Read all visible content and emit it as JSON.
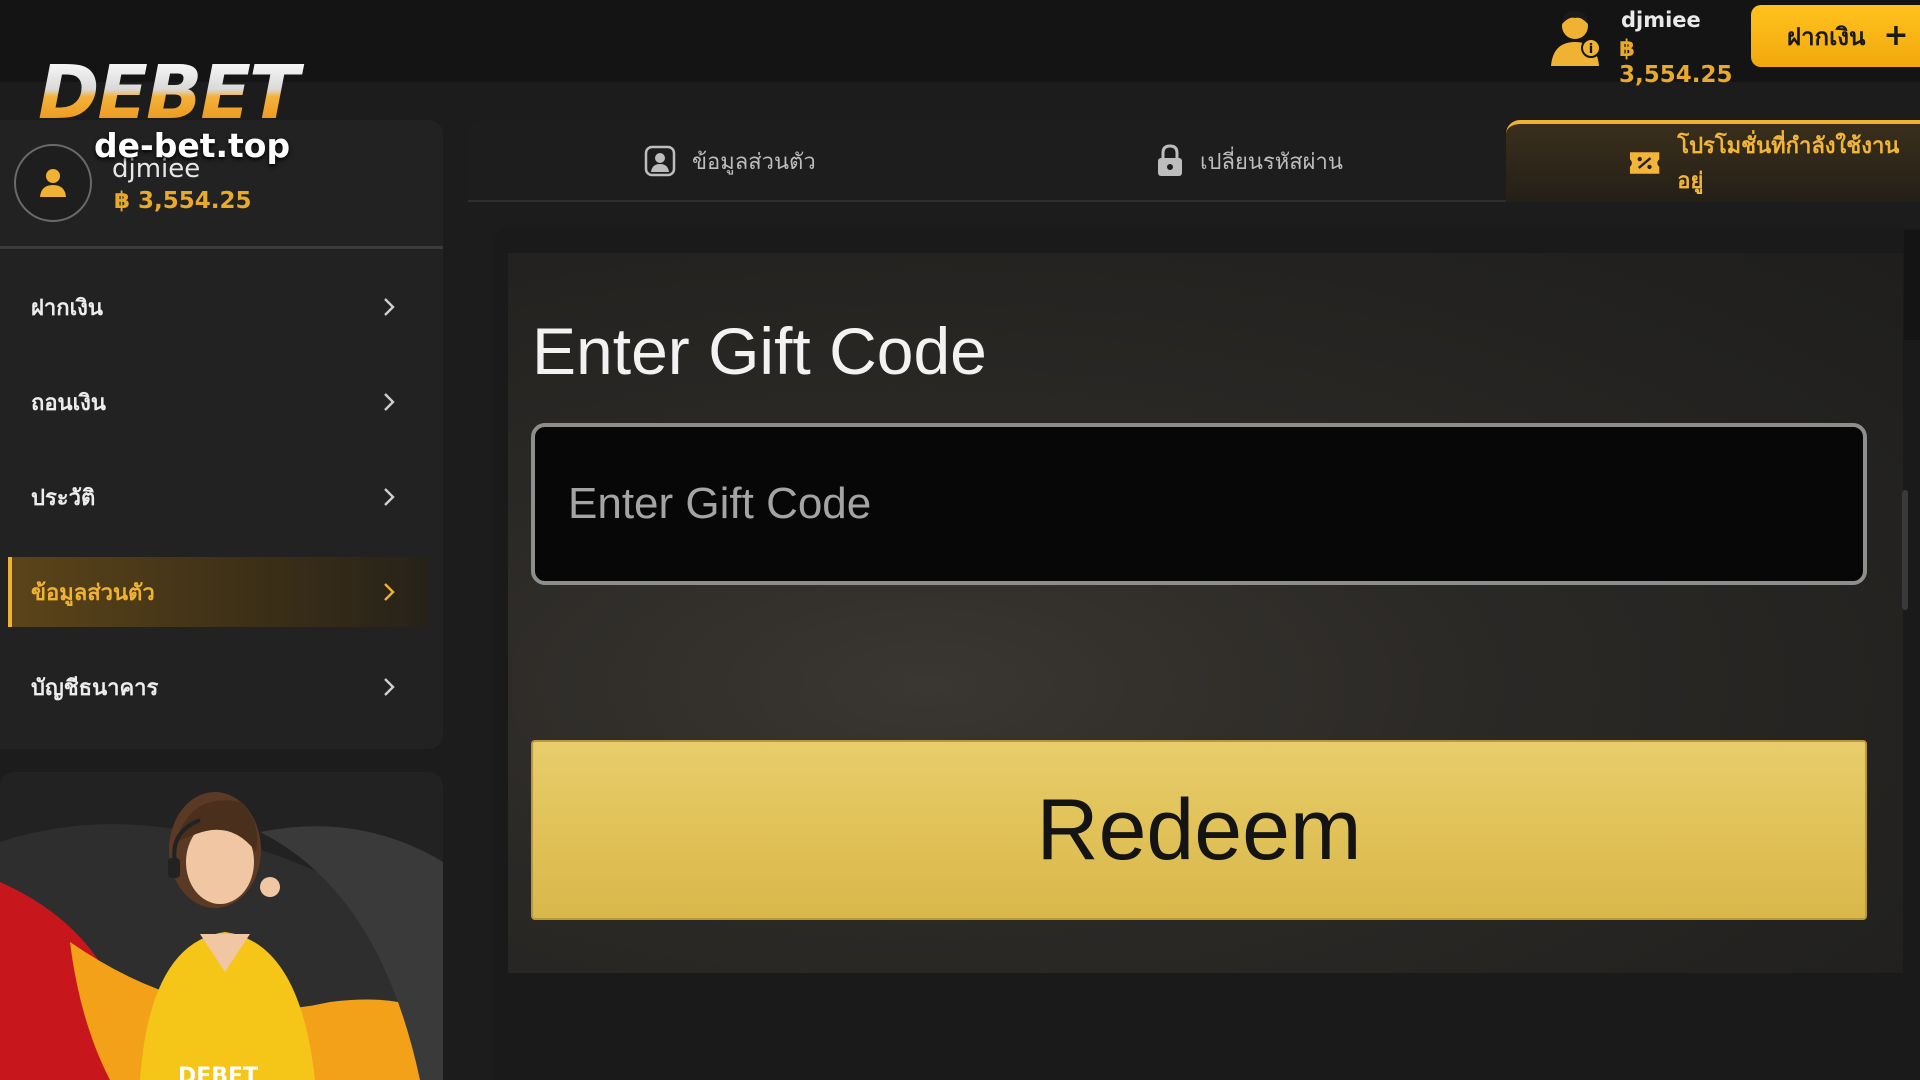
{
  "header": {
    "username": "djmiee",
    "balance": "฿ 3,554.25",
    "deposit_label": "ฝากเงิน",
    "deposit_plus": "+"
  },
  "logo": {
    "brand": "DEBET",
    "domain": "de-bet.top"
  },
  "profile": {
    "username": "djmiee",
    "balance": "฿ 3,554.25"
  },
  "sidebar": {
    "items": [
      {
        "label": "ฝากเงิน",
        "active": false
      },
      {
        "label": "ถอนเงิน",
        "active": false
      },
      {
        "label": "ประวัติ",
        "active": false
      },
      {
        "label": "ข้อมูลส่วนตัว",
        "active": true
      },
      {
        "label": "บัญชีธนาคาร",
        "active": false
      }
    ]
  },
  "agent": {
    "caption": "DEBET"
  },
  "tabs": [
    {
      "label": "ข้อมูลส่วนตัว",
      "icon": "user-card-icon",
      "active": false
    },
    {
      "label": "เปลี่ยนรหัสผ่าน",
      "icon": "lock-icon",
      "active": false
    },
    {
      "label": "โปรโมชั่นที่กำลังใช้งานอยู่",
      "icon": "ticket-icon",
      "active": true
    }
  ],
  "gift": {
    "title": "Enter Gift Code",
    "input_placeholder": "Enter Gift Code",
    "input_value": "",
    "redeem_label": "Redeem"
  },
  "colors": {
    "accent": "#f0b233",
    "balance": "#e9a92a",
    "redeem": "#e2c45c"
  }
}
